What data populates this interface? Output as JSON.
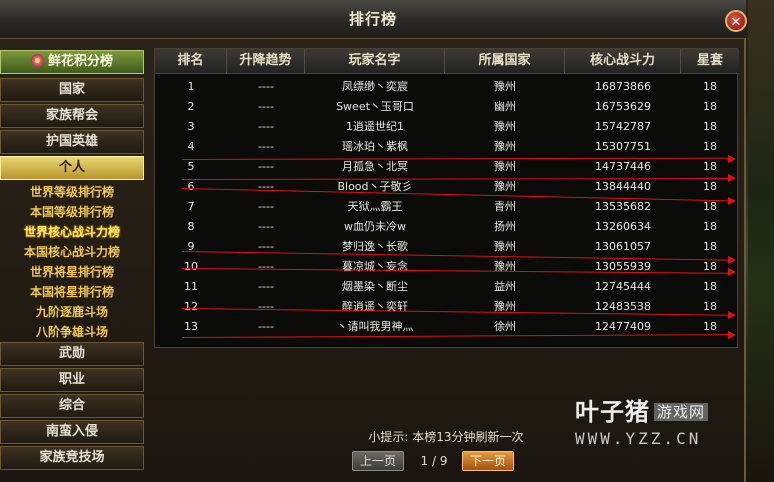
{
  "window": {
    "title": "排行榜",
    "close_symbol": "✕"
  },
  "sidebar": {
    "header": "鲜花积分榜",
    "categories_top": [
      "国家",
      "家族帮会",
      "护国英雄",
      "个人"
    ],
    "sub_items": [
      "世界等级排行榜",
      "本国等级排行榜",
      "世界核心战斗力榜",
      "本国核心战斗力榜",
      "世界将星排行榜",
      "本国将星排行榜",
      "九阶逐鹿斗场",
      "八阶争雄斗场"
    ],
    "categories_bottom": [
      "武勋",
      "职业",
      "综合",
      "南蛮入侵",
      "家族竞技场"
    ]
  },
  "table": {
    "headers": [
      "排名",
      "升降趋势",
      "玩家名字",
      "所属国家",
      "核心战斗力",
      "星套"
    ],
    "rows": [
      {
        "rank": "1",
        "trend": "----",
        "name": "凤缥缈丶奕宸",
        "country": "豫州",
        "power": "16873866",
        "star": "18"
      },
      {
        "rank": "2",
        "trend": "----",
        "name": "Sweet丶玉哥口",
        "country": "幽州",
        "power": "16753629",
        "star": "18"
      },
      {
        "rank": "3",
        "trend": "----",
        "name": "1逍遥世纪1",
        "country": "豫州",
        "power": "15742787",
        "star": "18"
      },
      {
        "rank": "4",
        "trend": "----",
        "name": "瑶冰珀丶紫枫",
        "country": "豫州",
        "power": "15307751",
        "star": "18"
      },
      {
        "rank": "5",
        "trend": "----",
        "name": "月孤急丶北冥",
        "country": "豫州",
        "power": "14737446",
        "star": "18"
      },
      {
        "rank": "6",
        "trend": "----",
        "name": "Blood丶子敬彡",
        "country": "豫州",
        "power": "13844440",
        "star": "18"
      },
      {
        "rank": "7",
        "trend": "----",
        "name": "天狱灬霸王",
        "country": "青州",
        "power": "13535682",
        "star": "18"
      },
      {
        "rank": "8",
        "trend": "----",
        "name": "w血仍未冷w",
        "country": "扬州",
        "power": "13260634",
        "star": "18"
      },
      {
        "rank": "9",
        "trend": "----",
        "name": "梦归逸丶长歌",
        "country": "豫州",
        "power": "13061057",
        "star": "18"
      },
      {
        "rank": "10",
        "trend": "----",
        "name": "暮凉城丶妄念",
        "country": "豫州",
        "power": "13055939",
        "star": "18"
      },
      {
        "rank": "11",
        "trend": "----",
        "name": "烟墨染丶断尘",
        "country": "益州",
        "power": "12745444",
        "star": "18"
      },
      {
        "rank": "12",
        "trend": "----",
        "name": "醉逍遥丶奕轩",
        "country": "豫州",
        "power": "12483538",
        "star": "18"
      },
      {
        "rank": "13",
        "trend": "----",
        "name": "丶请叫我男神灬",
        "country": "徐州",
        "power": "12477409",
        "star": "18"
      }
    ]
  },
  "footer": {
    "tip": "小提示: 本榜13分钟刷新一次",
    "prev_label": "上一页",
    "page_indicator": "1 / 9",
    "next_label": "下一页"
  },
  "watermark": {
    "brand": "叶子猪",
    "tag": "游戏网",
    "url": "WWW.YZZ.CN"
  },
  "colors": {
    "annotation_line": "#e01010",
    "active_tab": "#d6b94a",
    "sub_item_text": "#f2c94c"
  }
}
